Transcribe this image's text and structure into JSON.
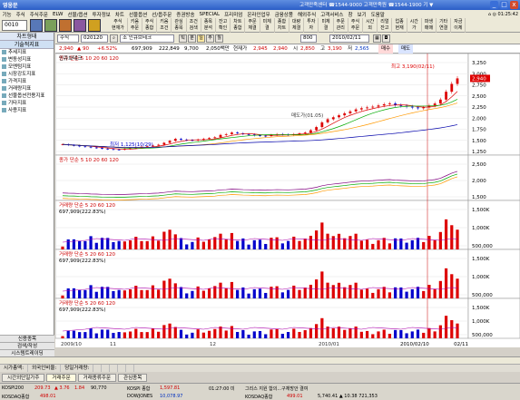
{
  "window": {
    "title": "영웅문",
    "center": "고객만족센터 ☎1544-9000 고객만족원 ☎1544-1900  기 ▼",
    "min": "_",
    "max": "□",
    "close": "x"
  },
  "menu": [
    "기능",
    "주식",
    "주식주문",
    "ELW",
    "선물/옵션",
    "투자정보",
    "차트",
    "선물옵션",
    "선/옵주문",
    "증권방송",
    "SPECIAL",
    "프리미엄",
    "온라인업무",
    "금융상품",
    "해외주식",
    "고객서비스",
    "창",
    "보기",
    "도움말"
  ],
  "menu_right": "⌂ ◎ 01:25:42",
  "toolbar": {
    "code": "0010",
    "cols": [
      [
        "주식",
        "현재가"
      ],
      [
        "키움",
        "주문"
      ],
      [
        "주식",
        "종합"
      ],
      [
        "키움",
        "조건"
      ],
      [
        "관심",
        "종목"
      ],
      [
        "조건",
        "검색"
      ],
      [
        "종목",
        "분석"
      ],
      [
        "잔고",
        "확인"
      ],
      [
        "차트",
        "종합"
      ],
      [
        "주문",
        "체결"
      ],
      [
        "미체",
        "결"
      ],
      [
        "종합",
        "차트"
      ],
      [
        "대량",
        "체결"
      ],
      [
        "투자",
        "자"
      ],
      [
        "미체",
        "결"
      ],
      [
        "주문",
        "관리"
      ],
      [
        "주식",
        "주문"
      ],
      [
        "시간",
        "외"
      ],
      [
        "리얼",
        "잔고"
      ],
      [
        "업종",
        "현재"
      ],
      [
        "시간",
        "가"
      ],
      [
        "파생",
        "매매"
      ],
      [
        "기타",
        "연결"
      ],
      [
        "자금",
        "이체"
      ]
    ]
  },
  "left_panel": {
    "title": "차트형태",
    "subtitle": "기술적지표",
    "items": [
      "추세지표",
      "변동성지표",
      "모멘텀지표",
      "시장강도지표",
      "가격지표",
      "거래량지표",
      "선물옵션전용지표",
      "기타지표",
      "사용지표"
    ],
    "bottom1": "신용종목",
    "bottom2": "검색/작성",
    "bottom3": "시스템트레이딩"
  },
  "chart_toolbar": {
    "market": "주식",
    "code": "020120",
    "name": "조 인큐브테크",
    "period": "일",
    "period2": "주",
    "period3": "월",
    "count": "800",
    "date": "2010/02/11"
  },
  "price_bar": {
    "price": "2,940",
    "change": "▲ 90",
    "pct": "+6.52%",
    "vol": "697,909",
    "amount": "222,849",
    "ratio": "9,700",
    "label1": "2,050백만",
    "label2": "현재가",
    "v1": "2,945",
    "v2": "2,940",
    "label3": "시",
    "v3": "2,850",
    "label4": "고",
    "v4": "3,190",
    "label5": "저",
    "v5": "2,565",
    "btn": "매수",
    "btn2": "매도"
  },
  "chart_data": [
    {
      "type": "line",
      "title": "인큐브테크",
      "legend": "종가 단순 5 10 20 60 120",
      "annotations": [
        "최고 3,190(02/11)",
        "최저 1,125(10/29)",
        "매도가(01.05)"
      ],
      "yticks": [
        "3,250",
        "3,000",
        "2,750",
        "2,500",
        "2,250",
        "2,000",
        "1,750",
        "1,500",
        "1,250"
      ],
      "ylim": [
        1125,
        3250
      ],
      "values": [
        1260,
        1240,
        1230,
        1210,
        1200,
        1180,
        1170,
        1150,
        1140,
        1130,
        1125,
        1145,
        1160,
        1180,
        1200,
        1210,
        1230,
        1250,
        1300,
        1350,
        1400,
        1380,
        1370,
        1360,
        1380,
        1400,
        1420,
        1440,
        1500,
        1520,
        1560,
        1540,
        1520,
        1510,
        1490,
        1480,
        1470,
        1500,
        1520,
        1510,
        1500,
        1520,
        1540,
        1560,
        1620,
        1700,
        1820,
        1900,
        1950,
        2000,
        2050,
        2100,
        2150,
        2180,
        2200,
        2220,
        2250,
        2280,
        2300,
        2260,
        2240,
        2220,
        2200,
        2180,
        2200,
        2250,
        2300,
        2400,
        2600,
        2800,
        2940
      ],
      "price_tag": "2,940"
    },
    {
      "type": "line",
      "legend": "종가 단순 5 10 20 60 120",
      "yticks": [
        "2,500",
        "2,000",
        "1,500"
      ]
    },
    {
      "type": "bar",
      "legend": "거래량 단순 5 20 60 120",
      "sub": "697,909(222.83%)",
      "yticks": [
        "1,500K",
        "1,000K",
        "500,000"
      ]
    },
    {
      "type": "bar",
      "legend": "거래량 단순 5 20 60 120",
      "sub": "697,909(222.83%)",
      "yticks": [
        "1,500K",
        "1,000K",
        "500,000"
      ]
    },
    {
      "type": "bar",
      "legend": "거래량 단순 5 20 60 120",
      "sub": "697,909(222.83%)",
      "yticks": [
        "1,500K",
        "1,000K",
        "500,000"
      ]
    }
  ],
  "xaxis": {
    "labels": [
      "2009/10",
      "11",
      "12",
      "2010/01",
      "2010/02/10",
      "02/11"
    ]
  },
  "status": [
    "시가총액:",
    "외국인비율:",
    "당일거래량:",
    "  ",
    "  ",
    "  ",
    "  ",
    "  "
  ],
  "tabs": [
    "시간외단일가주",
    "거래주문",
    "거래종류주문",
    "관심종목"
  ],
  "tab_active": 1,
  "ticker": {
    "kospi": "KOSPI200",
    "kospi_v": "209.73",
    "kospi_c": "▲ 3.76",
    "kospi_p": "1.84",
    "kospi_vol": "90,770",
    "kosdaq": "KOSDAQ종합",
    "kosdaq_v": "498.01",
    "dow": "DOWJONES",
    "dow_v": "10,078.97",
    "time": "01:27:00 미",
    "news": "그리스 지원 합의...구체방안 결여",
    "ko2": "KOSPI 종합",
    "ko2_v": "1,597.81",
    "ko3": "KOSDAQ종합",
    "ko3_v": "499.01",
    "r2": "5,740.41 ▲ 10.38  721,353"
  }
}
